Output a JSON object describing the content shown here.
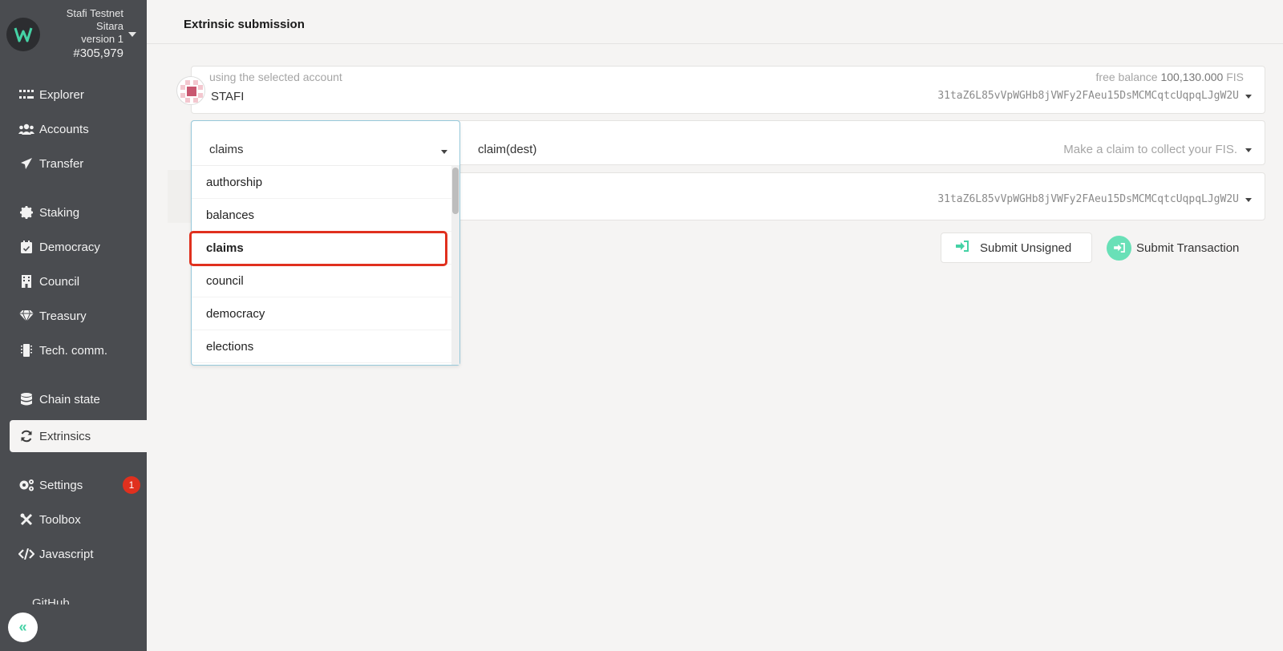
{
  "chain": {
    "name": "Stafi Testnet",
    "subname": "Sitara",
    "version": "version 1",
    "block": "#305,979"
  },
  "nav": {
    "items": [
      {
        "label": "Explorer",
        "icon": "grid-icon"
      },
      {
        "label": "Accounts",
        "icon": "users-icon"
      },
      {
        "label": "Transfer",
        "icon": "paper-plane-icon"
      },
      {
        "label": "Staking",
        "icon": "certificate-icon"
      },
      {
        "label": "Democracy",
        "icon": "calendar-check-icon"
      },
      {
        "label": "Council",
        "icon": "building-icon"
      },
      {
        "label": "Treasury",
        "icon": "gem-icon"
      },
      {
        "label": "Tech. comm.",
        "icon": "microchip-icon"
      },
      {
        "label": "Chain state",
        "icon": "database-icon"
      },
      {
        "label": "Extrinsics",
        "icon": "sync-icon"
      },
      {
        "label": "Settings",
        "icon": "cogs-icon",
        "badge": "1"
      },
      {
        "label": "Toolbox",
        "icon": "tools-icon"
      },
      {
        "label": "Javascript",
        "icon": "code-icon"
      }
    ],
    "github_label": "GitHub",
    "collapse_icon": "double-chevron-left-icon"
  },
  "page": {
    "tab_title": "Extrinsic submission"
  },
  "account": {
    "label": "using the selected account",
    "name": "STAFI",
    "balance_label": "free balance",
    "balance_value": "100,130.000",
    "balance_unit": "FIS",
    "address": "31taZ6L85vVpWGHb8jVWFy2FAeu15DsMCMCqtcUqpqLJgW2U"
  },
  "call": {
    "section": "claims",
    "method": "claim(dest)",
    "description": "Make a claim to collect your FIS."
  },
  "dest": {
    "address": "31taZ6L85vVpWGHb8jVWFy2FAeu15DsMCMCqtcUqpqLJgW2U"
  },
  "buttons": {
    "unsigned": "Submit Unsigned",
    "submit": "Submit Transaction"
  },
  "dropdown": {
    "options": [
      "authorship",
      "balances",
      "claims",
      "council",
      "democracy",
      "elections"
    ],
    "selected": "claims"
  },
  "colors": {
    "sidebar": "#4a4c50",
    "accent": "#45d2a5",
    "highlight": "#e0301e",
    "badge": "#e0301e"
  }
}
